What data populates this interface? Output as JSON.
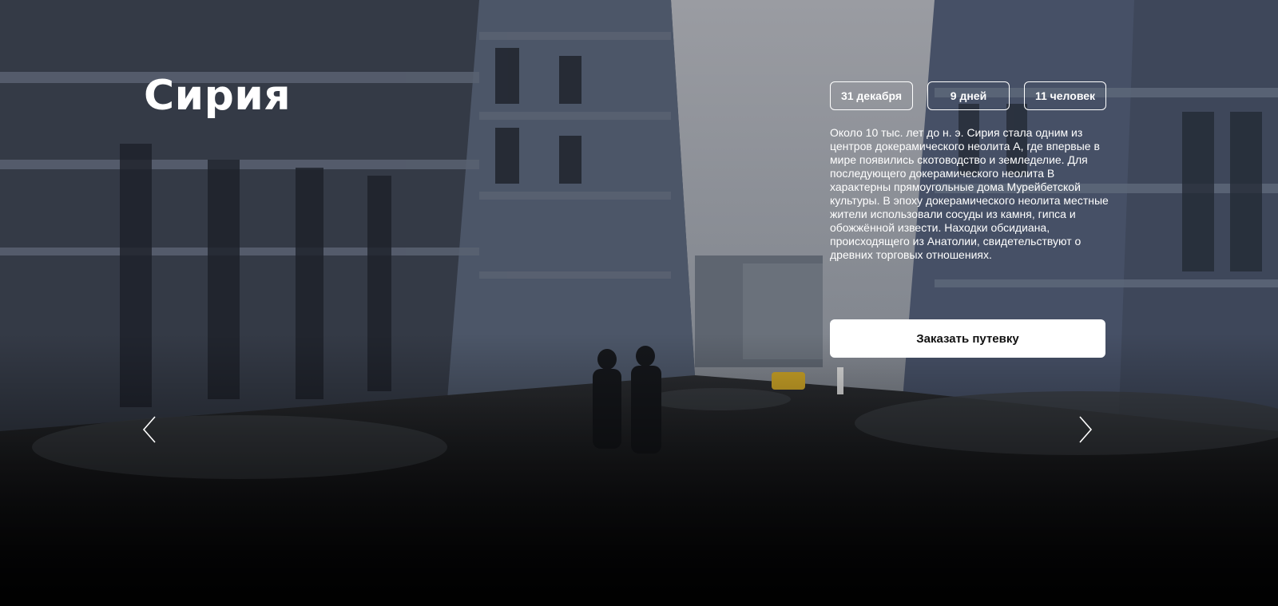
{
  "hero": {
    "title": "Сирия",
    "chips": {
      "date": "31 декабря",
      "days": "9 дней",
      "people": "11 человек"
    },
    "description": "Около 10 тыс. лет до н. э. Сирия стала одним из центров докерамического неолита A, где впервые в мире появились скотоводство и земледелие. Для последующего докерамического неолита B характерны прямоугольные дома Мурейбетской культуры. В эпоху докерамического неолита местные жители использовали сосуды из камня, гипса и обожжённой извести. Находки обсидиана, происходящего из Анатолии, свидетельствуют о древних торговых отношениях.",
    "cta_label": "Заказать путевку",
    "prev_icon": "chevron-left-icon",
    "next_icon": "chevron-right-icon",
    "colors": {
      "text": "#ffffff",
      "button_bg": "#ffffff",
      "button_text": "#111111"
    }
  }
}
